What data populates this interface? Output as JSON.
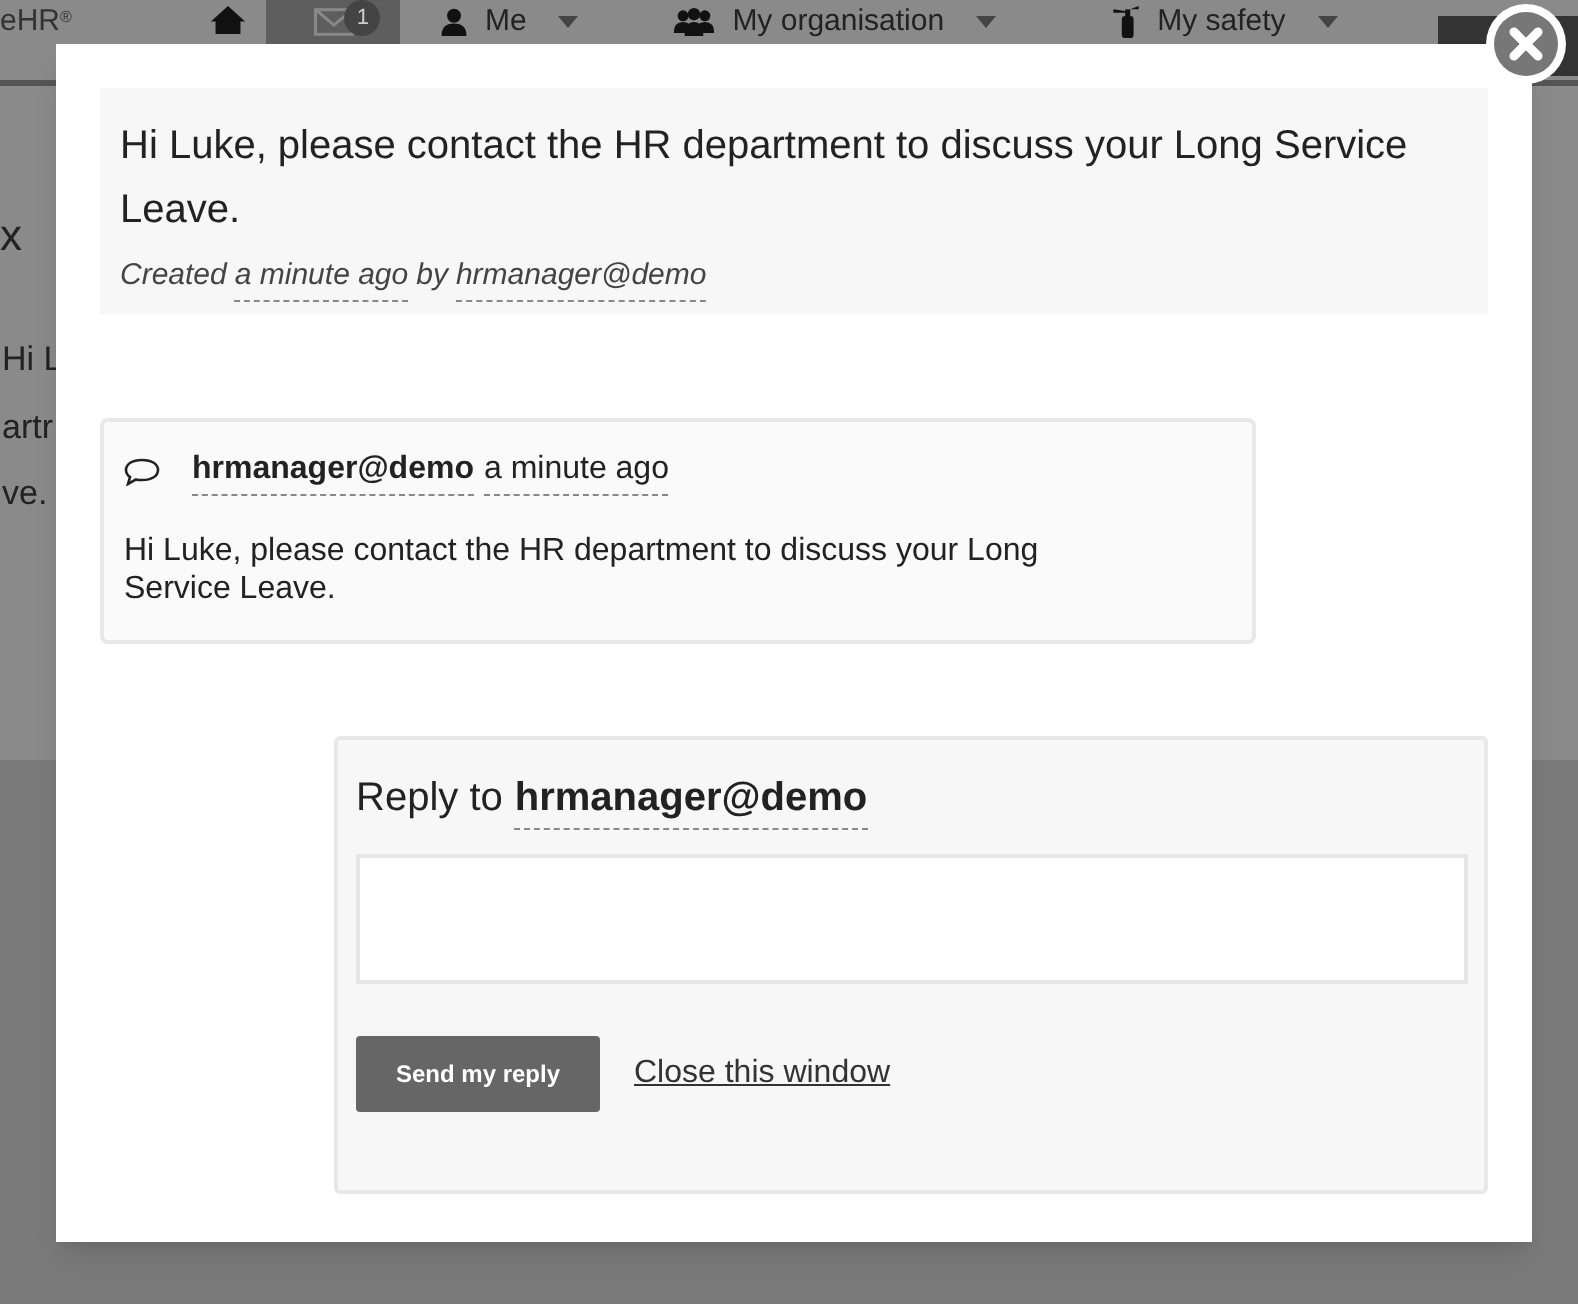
{
  "nav": {
    "logo": "eHR",
    "logo_mark": "®",
    "mail_badge": "1",
    "items": [
      {
        "label": "Me"
      },
      {
        "label": "My organisation"
      },
      {
        "label": "My safety"
      }
    ]
  },
  "background": {
    "heading": "x",
    "lines": [
      "Hi L",
      "artr",
      "ve."
    ]
  },
  "note": {
    "text": "Hi Luke, please contact the HR department to discuss your Long Service Leave.",
    "created_label": "Created",
    "time": "a minute ago",
    "by_label": "by",
    "author": "hrmanager@demo"
  },
  "comments": [
    {
      "author": "hrmanager@demo",
      "time": "a minute ago",
      "text": "Hi Luke, please contact the HR department to discuss your Long Service Leave."
    }
  ],
  "reply": {
    "label": "Reply to",
    "author": "hrmanager@demo",
    "send_button": "Send my reply",
    "close_link": "Close this window"
  }
}
